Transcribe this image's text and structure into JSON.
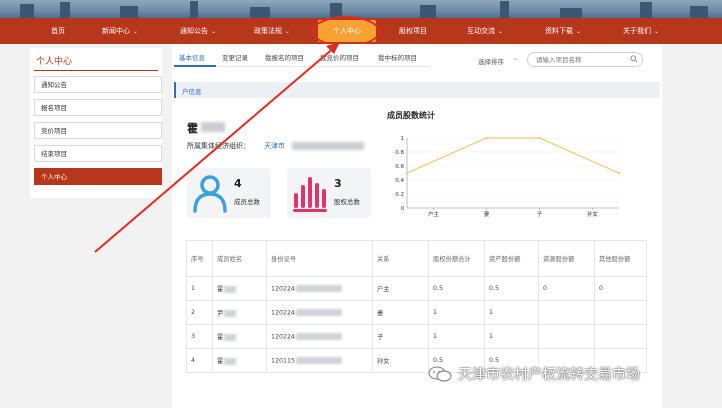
{
  "nav": {
    "items": [
      {
        "label": "首页",
        "caret": false
      },
      {
        "label": "新闻中心",
        "caret": true
      },
      {
        "label": "通知公告",
        "caret": true
      },
      {
        "label": "政策法规",
        "caret": true
      },
      {
        "label": "个人中心",
        "caret": false,
        "active": true
      },
      {
        "label": "股权项目",
        "caret": false
      },
      {
        "label": "互动交流",
        "caret": true
      },
      {
        "label": "资料下载",
        "caret": true
      },
      {
        "label": "关于我们",
        "caret": true
      }
    ],
    "caret_glyph": "⌄"
  },
  "sidebar": {
    "title": "个人中心",
    "items": [
      {
        "label": "通知公告"
      },
      {
        "label": "报名项目"
      },
      {
        "label": "竞价项目"
      },
      {
        "label": "结束项目"
      },
      {
        "label": "个人中心",
        "active": true
      }
    ]
  },
  "tabs": [
    {
      "label": "基本信息",
      "active": true
    },
    {
      "label": "变更记录"
    },
    {
      "label": "我报名的项目"
    },
    {
      "label": "我竞价的项目"
    },
    {
      "label": "我中标的项目"
    }
  ],
  "sort": {
    "label": "选择排序",
    "caret": "⌄"
  },
  "search": {
    "placeholder": "请输入项目名称"
  },
  "section": {
    "title": "户信息"
  },
  "profile": {
    "name": "霍",
    "org_label": "所属集体经济组织：",
    "org_value": "天津市"
  },
  "cards": [
    {
      "number": "4",
      "label": "成员总数",
      "icon": "people-icon"
    },
    {
      "number": "3",
      "label": "股权总数",
      "icon": "bar-chart-icon"
    }
  ],
  "colors": {
    "nav_bg": "#b6371c",
    "nav_active": "#f5a233",
    "accent_blue": "#2f6db5",
    "people_icon": "#3aa0e0",
    "bars_icon": "#e0336b",
    "line": "#f5c56e",
    "annotation_red": "#e02b1f"
  },
  "chart": {
    "title": "成员股数统计"
  },
  "chart_data": {
    "type": "line",
    "title": "成员股数统计",
    "categories": [
      "户主",
      "妻",
      "子",
      "孙女"
    ],
    "series": [
      {
        "values": [
          0.5,
          1,
          1,
          0.5
        ]
      }
    ],
    "ylim": [
      0,
      1
    ],
    "yticks": [
      "0",
      "0.2",
      "0.4",
      "0.6",
      "0.8",
      "1"
    ],
    "grid": true
  },
  "table": {
    "headers": [
      "序号",
      "成员姓名",
      "身份证号",
      "关系",
      "股权份额合计",
      "资产股份额",
      "资源股份额",
      "其他股份额"
    ],
    "rows": [
      {
        "no": "1",
        "name": "霍",
        "id": "120224",
        "rel": "户主",
        "total": "0.5",
        "asset": "0.5",
        "resource": "0",
        "other": "0"
      },
      {
        "no": "2",
        "name": "尹",
        "id": "120224",
        "rel": "妻",
        "total": "1",
        "asset": "1",
        "resource": "",
        "other": ""
      },
      {
        "no": "3",
        "name": "霍",
        "id": "120224",
        "rel": "子",
        "total": "1",
        "asset": "1",
        "resource": "",
        "other": ""
      },
      {
        "no": "4",
        "name": "霍",
        "id": "120115",
        "rel": "孙女",
        "total": "0.5",
        "asset": "0.5",
        "resource": "",
        "other": ""
      }
    ]
  },
  "watermark": {
    "text": "天津市农村产权流转交易市场",
    "icon": "wechat-icon"
  }
}
